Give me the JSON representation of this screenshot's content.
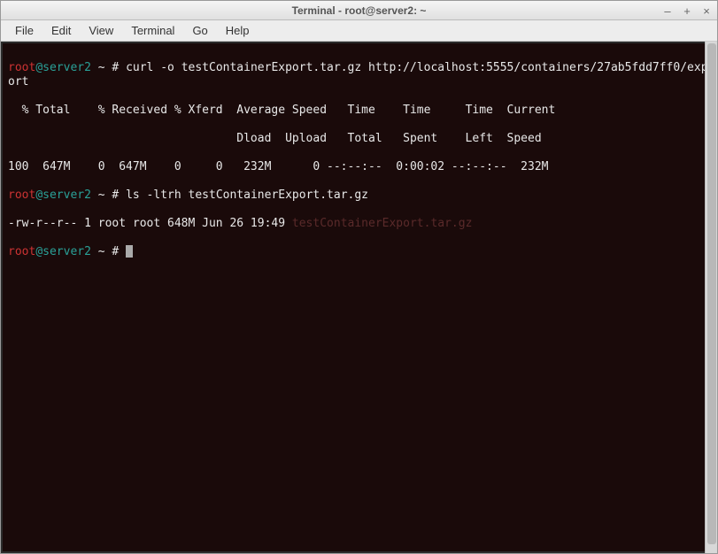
{
  "window": {
    "title": "Terminal - root@server2: ~"
  },
  "menu": {
    "file": "File",
    "edit": "Edit",
    "view": "View",
    "terminal": "Terminal",
    "go": "Go",
    "help": "Help"
  },
  "prompt": {
    "user": "root",
    "at": "@",
    "host": "server2",
    "path": " ~ # "
  },
  "lines": {
    "cmd1": "curl -o testContainerExport.tar.gz http://localhost:5555/containers/27ab5fdd7ff0/export",
    "header1": "  % Total    % Received % Xferd  Average Speed   Time    Time     Time  Current",
    "header2": "                                 Dload  Upload   Total   Spent    Left  Speed",
    "progress": "100  647M    0  647M    0     0   232M      0 --:--:--  0:00:02 --:--:--  232M",
    "cmd2": "ls -ltrh testContainerExport.tar.gz",
    "ls_prefix": "-rw-r--r-- 1 root root 648M Jun 26 19:49 ",
    "ls_file": "testContainerExport.tar.gz"
  }
}
